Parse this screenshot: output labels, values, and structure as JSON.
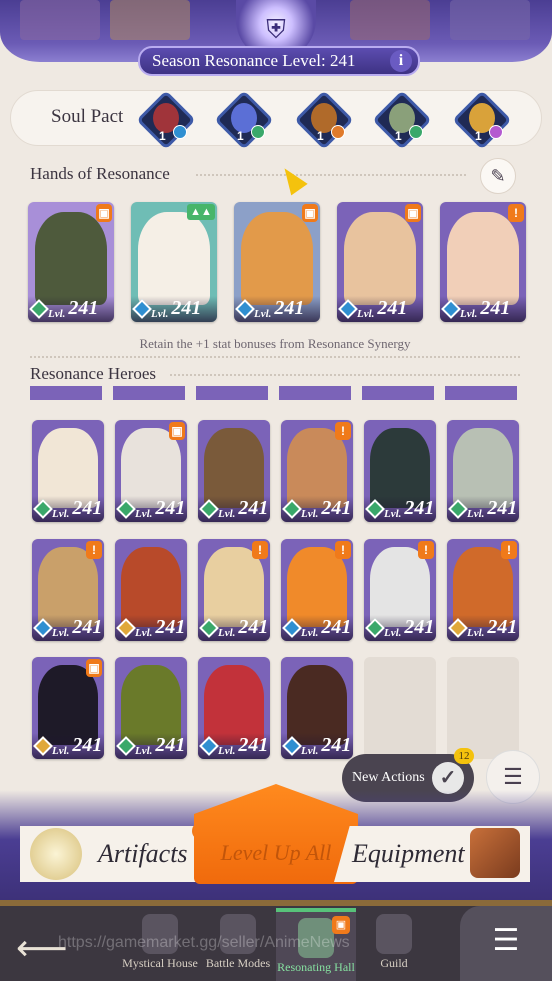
{
  "header": {
    "season_label": "Season Resonance Level: 241",
    "info_icon": "i"
  },
  "soul_pact": {
    "label": "Soul Pact",
    "slots": [
      {
        "count": "1",
        "badge_color": "#2f8fd1",
        "face_color": "#a0343a"
      },
      {
        "count": "1",
        "badge_color": "#3aa86a",
        "face_color": "#5b6fd6"
      },
      {
        "count": "1",
        "badge_color": "#e07a2a",
        "face_color": "#b06a2a"
      },
      {
        "count": "1",
        "badge_color": "#3aa86a",
        "face_color": "#8aa07a"
      },
      {
        "count": "1",
        "badge_color": "#b45ad0",
        "face_color": "#d9a23a"
      }
    ]
  },
  "hands_of_resonance": {
    "title": "Hands of Resonance",
    "hint": "Retain the +1 stat bonuses from Resonance Synergy",
    "heroes": [
      {
        "lvl_prefix": "Lvl.",
        "level": "241",
        "bg": "#a88fd8",
        "face": "#4e5a3c",
        "faction": "#3aa86a",
        "marker": "gift"
      },
      {
        "lvl_prefix": "Lvl.",
        "level": "241",
        "bg": "#6fbdb5",
        "face": "#f5efe6",
        "faction": "#2f8fd1",
        "marker": "up"
      },
      {
        "lvl_prefix": "Lvl.",
        "level": "241",
        "bg": "#8ca0c8",
        "face": "#e29a4a",
        "faction": "#2f8fd1",
        "marker": "gift"
      },
      {
        "lvl_prefix": "Lvl.",
        "level": "241",
        "bg": "#7b63b8",
        "face": "#e8c39e",
        "faction": "#2f8fd1",
        "marker": "gift"
      },
      {
        "lvl_prefix": "Lvl.",
        "level": "241",
        "bg": "#7b63b8",
        "face": "#f1cfb8",
        "faction": "#2f8fd1",
        "marker": "alert"
      }
    ]
  },
  "resonance_heroes": {
    "title": "Resonance Heroes",
    "rows": [
      [
        {
          "lvl_prefix": "Lvl.",
          "level": "241",
          "face": "#f1e6d6",
          "faction": "#3aa86a",
          "marker": ""
        },
        {
          "lvl_prefix": "Lvl.",
          "level": "241",
          "face": "#e8e2dc",
          "faction": "#3aa86a",
          "marker": "gift"
        },
        {
          "lvl_prefix": "Lvl.",
          "level": "241",
          "face": "#7a5a3a",
          "faction": "#3aa86a",
          "marker": ""
        },
        {
          "lvl_prefix": "Lvl.",
          "level": "241",
          "face": "#c98a5a",
          "faction": "#3aa86a",
          "marker": "alert"
        },
        {
          "lvl_prefix": "Lvl.",
          "level": "241",
          "face": "#2c3a3a",
          "faction": "#3aa86a",
          "marker": ""
        },
        {
          "lvl_prefix": "Lvl.",
          "level": "241",
          "face": "#b8c0b4",
          "faction": "#3aa86a",
          "marker": ""
        }
      ],
      [
        {
          "lvl_prefix": "Lvl.",
          "level": "241",
          "face": "#c9a06a",
          "faction": "#2f8fd1",
          "marker": "alert"
        },
        {
          "lvl_prefix": "Lvl.",
          "level": "241",
          "face": "#b84a2a",
          "faction": "#e0a83a",
          "marker": ""
        },
        {
          "lvl_prefix": "Lvl.",
          "level": "241",
          "face": "#e8cfa0",
          "faction": "#3aa86a",
          "marker": "alert"
        },
        {
          "lvl_prefix": "Lvl.",
          "level": "241",
          "face": "#f08a2a",
          "faction": "#2f8fd1",
          "marker": "alert"
        },
        {
          "lvl_prefix": "Lvl.",
          "level": "241",
          "face": "#e4e4e4",
          "faction": "#3aa86a",
          "marker": "alert"
        },
        {
          "lvl_prefix": "Lvl.",
          "level": "241",
          "face": "#d06a2a",
          "faction": "#e0a83a",
          "marker": "alert"
        }
      ],
      [
        {
          "lvl_prefix": "Lvl.",
          "level": "241",
          "face": "#1e1a28",
          "faction": "#e0a83a",
          "marker": "gift"
        },
        {
          "lvl_prefix": "Lvl.",
          "level": "241",
          "face": "#6a7a2a",
          "faction": "#3aa86a",
          "marker": ""
        },
        {
          "lvl_prefix": "Lvl.",
          "level": "241",
          "face": "#c2323a",
          "faction": "#2f8fd1",
          "marker": ""
        },
        {
          "lvl_prefix": "Lvl.",
          "level": "241",
          "face": "#4a2a22",
          "faction": "#2f8fd1",
          "marker": ""
        }
      ]
    ]
  },
  "floating": {
    "new_actions_label": "New Actions",
    "new_actions_count": "12",
    "filter_icon": "☰"
  },
  "actions": {
    "artifacts_label": "Artifacts",
    "level_up_label": "Level Up All",
    "equipment_label": "Equipment"
  },
  "nav": {
    "back_icon": "⟵",
    "items": [
      {
        "label": "Mystical House"
      },
      {
        "label": "Battle Modes"
      },
      {
        "label": "Resonating Hall"
      },
      {
        "label": "Guild"
      }
    ],
    "menu_icon": "☰"
  },
  "watermark": "https://gamemarket.gg/seller/AnimeNews"
}
